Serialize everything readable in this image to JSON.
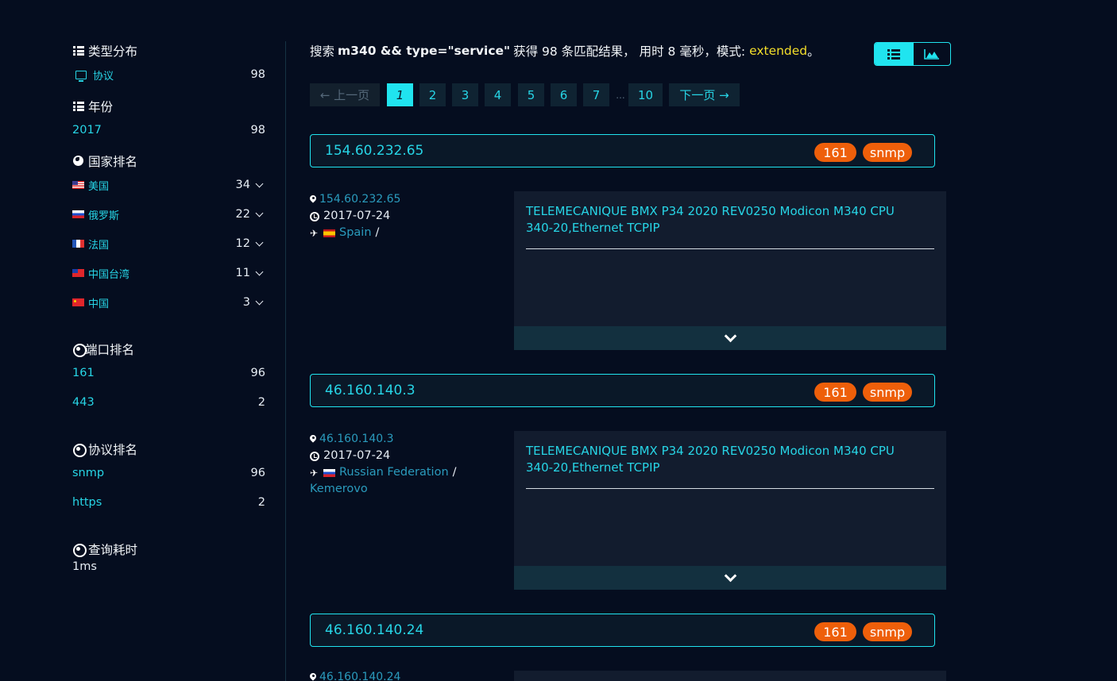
{
  "sidebar": {
    "type_title": "类型分布",
    "type_items": [
      {
        "label": "协议",
        "count": "98"
      }
    ],
    "year_title": "年份",
    "year_items": [
      {
        "label": "2017",
        "count": "98"
      }
    ],
    "country_title": "国家排名",
    "country_items": [
      {
        "label": "美国",
        "count": "34",
        "flag": "us"
      },
      {
        "label": "俄罗斯",
        "count": "22",
        "flag": "ru"
      },
      {
        "label": "法国",
        "count": "12",
        "flag": "fr"
      },
      {
        "label": "中国台湾",
        "count": "11",
        "flag": "tw"
      },
      {
        "label": "中国",
        "count": "3",
        "flag": "cn"
      }
    ],
    "port_title": "端口排名",
    "port_items": [
      {
        "label": "161",
        "count": "96"
      },
      {
        "label": "443",
        "count": "2"
      }
    ],
    "protocol_title": "协议排名",
    "protocol_items": [
      {
        "label": "snmp",
        "count": "96"
      },
      {
        "label": "https",
        "count": "2"
      }
    ],
    "time_title": "查询耗时",
    "time_value": "1ms"
  },
  "summary": {
    "prefix": "搜索",
    "query": "m340 && type=\"service\"",
    "middle": "获得 98 条匹配结果， 用时 8 毫秒，模式:",
    "mode": "extended",
    "suffix": "。"
  },
  "pagination": {
    "prev": "← 上一页",
    "pages": [
      "1",
      "2",
      "3",
      "4",
      "5",
      "6",
      "7"
    ],
    "dots": "...",
    "last": "10",
    "next": "下一页 →",
    "current": "1"
  },
  "results": [
    {
      "ip": "154.60.232.65",
      "port": "161",
      "protocol": "snmp",
      "date": "2017-07-24",
      "country": "Spain",
      "city": "",
      "banner": "TELEMECANIQUE BMX P34 2020 REV0250 Modicon M340 CPU 340-20,Ethernet TCPIP"
    },
    {
      "ip": "46.160.140.3",
      "port": "161",
      "protocol": "snmp",
      "date": "2017-07-24",
      "country": "Russian Federation",
      "city": "Kemerovo",
      "banner": "TELEMECANIQUE BMX P34 2020 REV0250 Modicon M340 CPU 340-20,Ethernet TCPIP"
    },
    {
      "ip": "46.160.140.24",
      "port": "161",
      "protocol": "snmp",
      "date": "",
      "country": "",
      "city": "",
      "banner": ""
    }
  ],
  "separator_slash": "/",
  "colors": {
    "accent": "#20e4ef",
    "link": "#27d5e6",
    "badge": "#ee5f0a",
    "mode": "#f5df2a",
    "background": "#050d1f"
  }
}
